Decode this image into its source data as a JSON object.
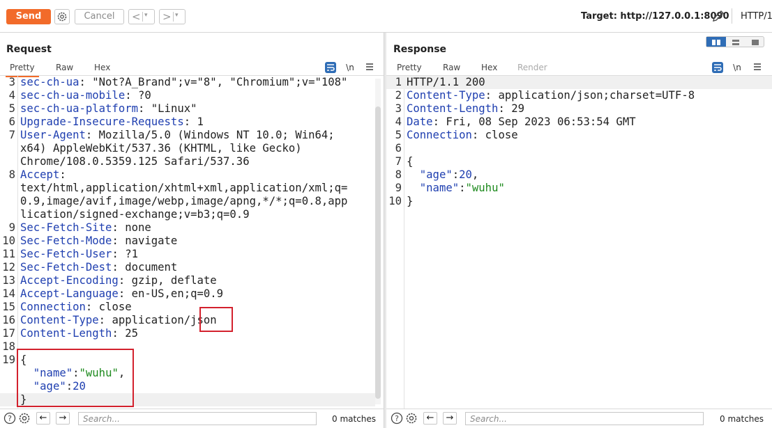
{
  "toolbar": {
    "send_label": "Send",
    "cancel_label": "Cancel",
    "back_glyph": "<",
    "forward_glyph": ">",
    "dropdown_glyph": "▾",
    "target_label": "Target: http://127.0.0.1:8090",
    "protocol_label": "HTTP/1",
    "accent_color": "#f26b2a"
  },
  "request": {
    "title": "Request",
    "tabs": [
      "Pretty",
      "Raw",
      "Hex"
    ],
    "active_tab": "Pretty",
    "newline_toggle": "\\n",
    "lines": [
      {
        "n": "3",
        "k": "sec-ch-ua",
        "v": " \"Not?A_Brand\";v=\"8\", \"Chromium\";v=\"108\""
      },
      {
        "n": "4",
        "k": "sec-ch-ua-mobile",
        "v": " ?0"
      },
      {
        "n": "5",
        "k": "sec-ch-ua-platform",
        "v": " \"Linux\""
      },
      {
        "n": "6",
        "k": "Upgrade-Insecure-Requests",
        "v": " 1"
      },
      {
        "n": "7",
        "k": "User-Agent",
        "v": " Mozilla/5.0 (Windows NT 10.0; Win64;"
      },
      {
        "n": "",
        "k": "",
        "v": "x64) AppleWebKit/537.36 (KHTML, like Gecko)"
      },
      {
        "n": "",
        "k": "",
        "v": "Chrome/108.0.5359.125 Safari/537.36"
      },
      {
        "n": "8",
        "k": "Accept",
        "v": ""
      },
      {
        "n": "",
        "k": "",
        "v": "text/html,application/xhtml+xml,application/xml;q="
      },
      {
        "n": "",
        "k": "",
        "v": "0.9,image/avif,image/webp,image/apng,*/*;q=0.8,app"
      },
      {
        "n": "",
        "k": "",
        "v": "lication/signed-exchange;v=b3;q=0.9"
      },
      {
        "n": "9",
        "k": "Sec-Fetch-Site",
        "v": " none"
      },
      {
        "n": "10",
        "k": "Sec-Fetch-Mode",
        "v": " navigate"
      },
      {
        "n": "11",
        "k": "Sec-Fetch-User",
        "v": " ?1"
      },
      {
        "n": "12",
        "k": "Sec-Fetch-Dest",
        "v": " document"
      },
      {
        "n": "13",
        "k": "Accept-Encoding",
        "v": " gzip, deflate"
      },
      {
        "n": "14",
        "k": "Accept-Language",
        "v": " en-US,en;q=0.9"
      },
      {
        "n": "15",
        "k": "Connection",
        "v": " close"
      },
      {
        "n": "16",
        "k": "Content-Type",
        "v": " application/json"
      },
      {
        "n": "17",
        "k": "Content-Length",
        "v": " 25"
      },
      {
        "n": "18",
        "k": "",
        "v": ""
      },
      {
        "n": "19",
        "k": "",
        "v": "{"
      },
      {
        "n": "",
        "json": [
          [
            "  ",
            ""
          ],
          [
            "\"name\"",
            "hkey"
          ],
          [
            ":",
            ""
          ],
          [
            "\"wuhu\"",
            "str"
          ],
          [
            ",",
            ""
          ]
        ]
      },
      {
        "n": "",
        "json": [
          [
            "  ",
            ""
          ],
          [
            "\"age\"",
            "hkey"
          ],
          [
            ":",
            ""
          ],
          [
            "20",
            "num"
          ]
        ]
      },
      {
        "n": "",
        "k": "",
        "v": "}",
        "cur": true
      }
    ],
    "search_placeholder": "Search...",
    "matches": "0 matches"
  },
  "response": {
    "title": "Response",
    "tabs": [
      "Pretty",
      "Raw",
      "Hex",
      "Render"
    ],
    "active_tab": "Pretty",
    "newline_toggle": "\\n",
    "lines": [
      {
        "n": "1",
        "k": "",
        "v": "HTTP/1.1 200",
        "cur": true
      },
      {
        "n": "2",
        "k": "Content-Type",
        "v": " application/json;charset=UTF-8"
      },
      {
        "n": "3",
        "k": "Content-Length",
        "v": " 29"
      },
      {
        "n": "4",
        "k": "Date",
        "v": " Fri, 08 Sep 2023 06:53:54 GMT"
      },
      {
        "n": "5",
        "k": "Connection",
        "v": " close"
      },
      {
        "n": "6",
        "k": "",
        "v": ""
      },
      {
        "n": "7",
        "k": "",
        "v": "{"
      },
      {
        "n": "8",
        "json": [
          [
            "  ",
            ""
          ],
          [
            "\"age\"",
            "hkey"
          ],
          [
            ":",
            ""
          ],
          [
            "20",
            "num"
          ],
          [
            ",",
            ""
          ]
        ]
      },
      {
        "n": "9",
        "json": [
          [
            "  ",
            ""
          ],
          [
            "\"name\"",
            "hkey"
          ],
          [
            ":",
            ""
          ],
          [
            "\"wuhu\"",
            "str"
          ]
        ]
      },
      {
        "n": "10",
        "k": "",
        "v": "}"
      }
    ],
    "search_placeholder": "Search...",
    "matches": "0 matches"
  }
}
